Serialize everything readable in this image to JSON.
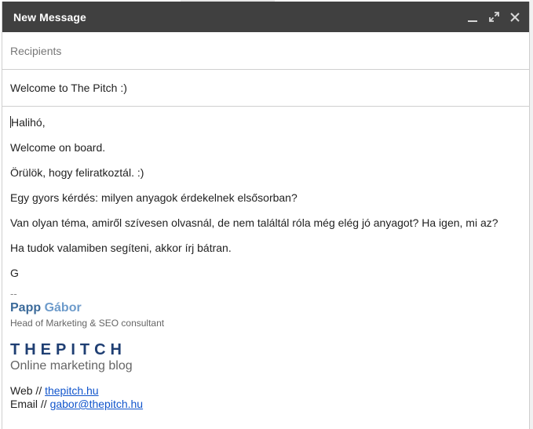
{
  "window": {
    "title": "New Message",
    "controls": {
      "minimize_icon": "minimize-icon",
      "expand_icon": "expand-icon",
      "close_icon": "close-icon"
    }
  },
  "recipients": {
    "placeholder": "Recipients",
    "value": ""
  },
  "subject": {
    "value": "Welcome to The Pitch :)"
  },
  "body": {
    "lines": [
      "Halihó,",
      "Welcome on board.",
      "Örülök, hogy feliratkoztál. :)",
      "Egy gyors kérdés: milyen anyagok érdekelnek elsősorban?",
      "Van olyan téma, amiről szívesen olvasnál, de nem találtál róla még elég jó anyagot? Ha igen, mi az?",
      "Ha tudok valamiben segíteni, akkor írj bátran.",
      "G"
    ]
  },
  "signature": {
    "separator": "--",
    "first_name": "Papp",
    "last_name": "Gábor",
    "role": "Head of Marketing & SEO consultant",
    "brand": "THEPITCH",
    "brand_tagline": "Online marketing blog",
    "web_label": "Web //",
    "web_link": "thepitch.hu",
    "email_label": "Email //",
    "email_link": "gabor@thepitch.hu"
  },
  "colors": {
    "titlebar": "#404040",
    "link": "#1155cc",
    "brand": "#1f3f73",
    "name_first": "#3b6a9a",
    "name_last": "#6d9bcb"
  }
}
